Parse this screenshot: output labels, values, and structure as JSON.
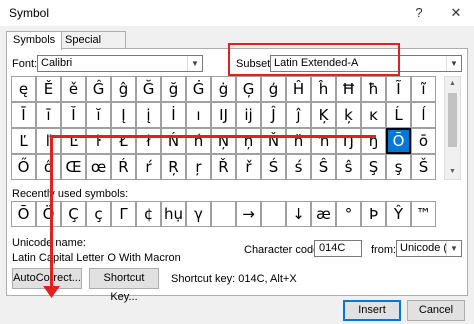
{
  "window": {
    "title": "Symbol",
    "help_label": "?",
    "close_label": "✕"
  },
  "tabs": [
    {
      "label": "Symbols",
      "active": true
    },
    {
      "label": "Special Characters",
      "active": false
    }
  ],
  "font": {
    "label": "Font:",
    "value": "Calibri"
  },
  "subset": {
    "label": "Subset:",
    "value": "Latin Extended-A"
  },
  "grid": {
    "rows": [
      [
        "ę",
        "Ě",
        "ě",
        "Ĝ",
        "ĝ",
        "Ğ",
        "ğ",
        "Ġ",
        "ġ",
        "Ģ",
        "ģ",
        "Ĥ",
        "ĥ",
        "Ħ",
        "ħ",
        "Ĩ",
        "ĩ"
      ],
      [
        "Ī",
        "ī",
        "Ĭ",
        "ĭ",
        "Į",
        "į",
        "İ",
        "ı",
        "Ĳ",
        "ĳ",
        "Ĵ",
        "ĵ",
        "Ķ",
        "ķ",
        "ĸ",
        "Ĺ",
        "ĺ"
      ],
      [
        "Ľ",
        "ľ",
        "Ŀ",
        "ŀ",
        "Ł",
        "ł",
        "Ń",
        "ń",
        "Ņ",
        "ņ",
        "Ň",
        "ň",
        "ŉ",
        "Ŋ",
        "ŋ",
        "Ō",
        "ō"
      ],
      [
        "Ő",
        "ő",
        "Œ",
        "œ",
        "Ŕ",
        "ŕ",
        "Ŗ",
        "ŗ",
        "Ř",
        "ř",
        "Ś",
        "ś",
        "Ŝ",
        "ŝ",
        "Ş",
        "ş",
        "Š"
      ]
    ],
    "selected_char": "Ō"
  },
  "recent": {
    "label": "Recently used symbols:",
    "symbols": [
      "Ō",
      "Ö",
      "Ç",
      "ç",
      "Γ",
      "¢",
      "hụ",
      "γ",
      " ",
      "→",
      " ",
      "↓",
      "æ",
      "°",
      "Þ",
      "Ŷ",
      "™"
    ]
  },
  "unicode": {
    "name_label": "Unicode name:",
    "name_value": "Latin Capital Letter O With Macron",
    "code_label": "Character code:",
    "code_value": "014C",
    "from_label": "from:",
    "from_value": "Unicode (hex)"
  },
  "buttons": {
    "autocorrect": "AutoCorrect...",
    "shortcut": "Shortcut Key...",
    "shortcut_text": "Shortcut key: 014C, Alt+X",
    "insert": "Insert",
    "cancel": "Cancel"
  },
  "colors": {
    "highlight": "#e32020",
    "selection": "#0078d7"
  }
}
